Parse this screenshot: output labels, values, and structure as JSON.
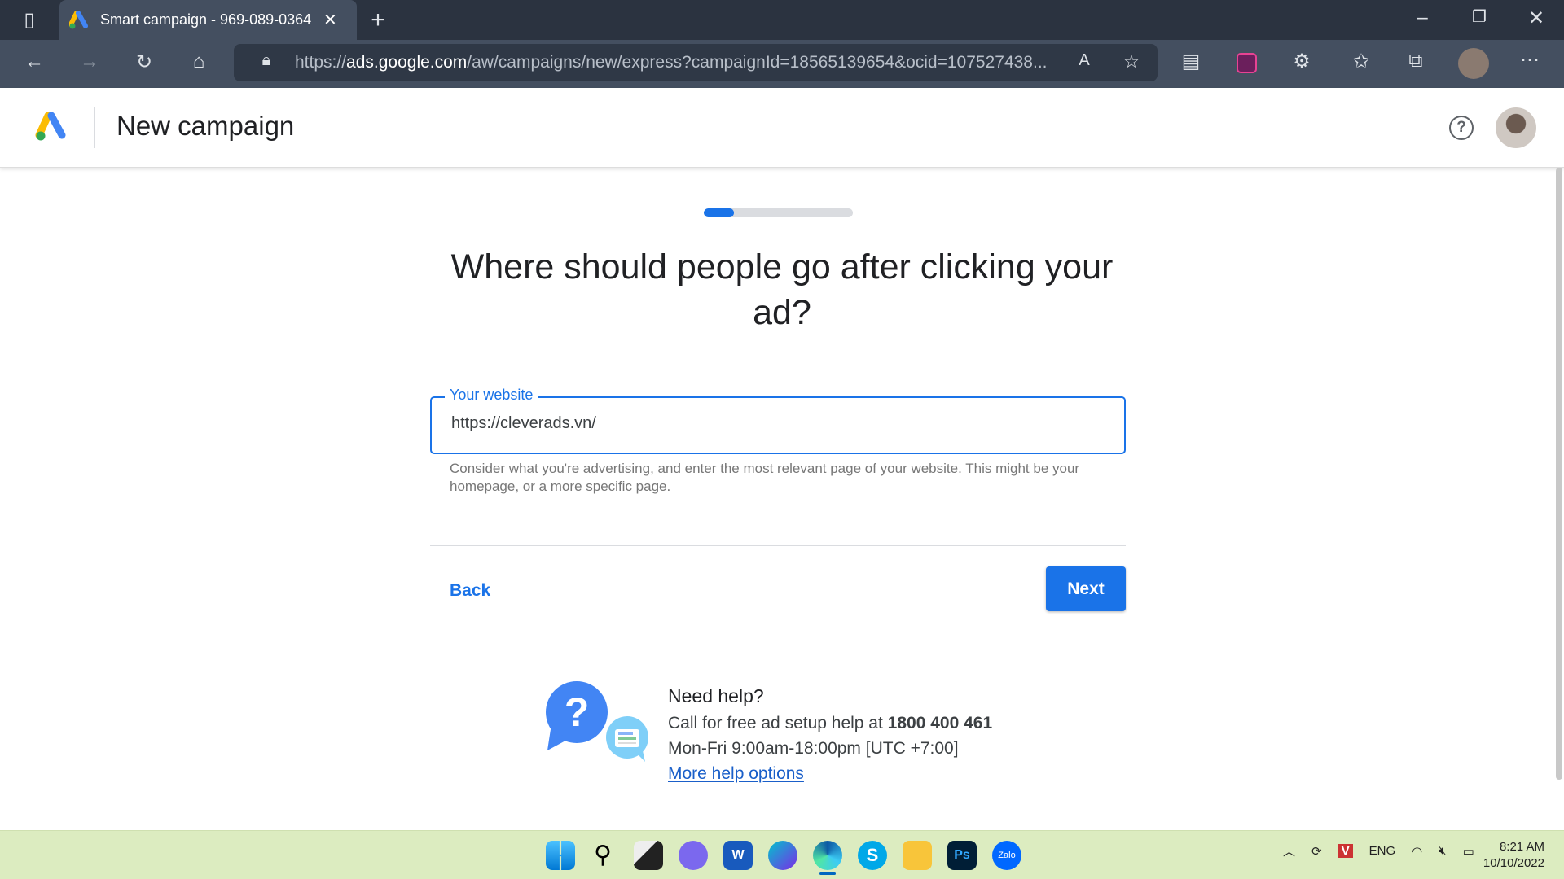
{
  "browser": {
    "tab_title": "Smart campaign - 969-089-0364",
    "url_prefix": "https://",
    "url_domain": "ads.google.com",
    "url_rest": "/aw/campaigns/new/express?campaignId=18565139654&ocid=107527438..."
  },
  "header": {
    "title": "New campaign"
  },
  "progress": {
    "percent": 20
  },
  "main": {
    "question": "Where should people go after clicking your ad?",
    "field_label": "Your website",
    "field_value": "https://cleverads.vn/",
    "helper": "Consider what you're advertising, and enter the most relevant page of your website. This might be your homepage, or a more specific page.",
    "back_label": "Back",
    "next_label": "Next"
  },
  "help": {
    "title": "Need help?",
    "call_text": "Call for free ad setup help at ",
    "phone": "1800 400 461",
    "hours": "Mon-Fri 9:00am-18:00pm [UTC +7:00]",
    "more_link": "More help options"
  },
  "taskbar": {
    "lang": "ENG",
    "time": "8:21 AM",
    "date": "10/10/2022"
  },
  "colors": {
    "accent": "#1a73e8",
    "browser_dark": "#2b3340",
    "taskbar": "#dcecc0"
  }
}
